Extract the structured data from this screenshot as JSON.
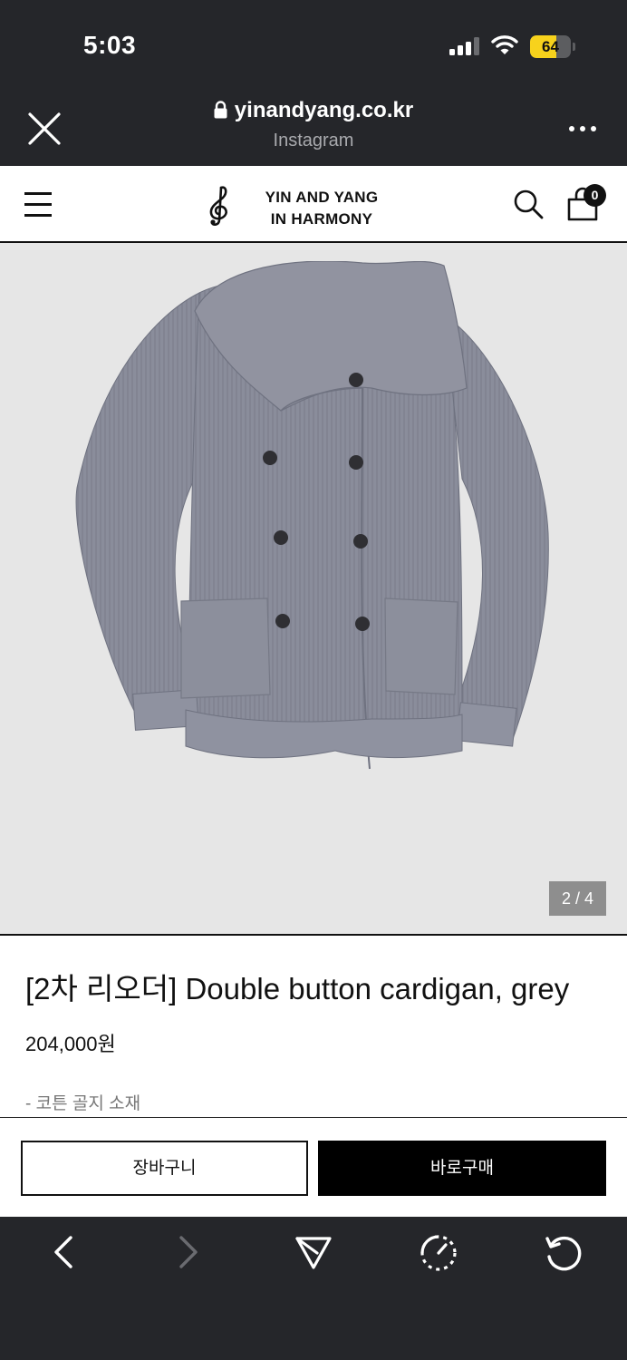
{
  "status_bar": {
    "time": "5:03",
    "battery_percent": "64",
    "battery_level": 0.64,
    "battery_color": "#f7d21c"
  },
  "browser": {
    "url": "yinandyang.co.kr",
    "source": "Instagram",
    "icons": [
      "close-icon",
      "lock-icon",
      "more-icon",
      "back-icon",
      "forward-icon",
      "share-icon",
      "compass-icon",
      "reload-icon"
    ]
  },
  "site": {
    "logo_line1": "YIN AND YANG",
    "logo_line2": "IN HARMONY",
    "cart_count": "0",
    "icons": [
      "menu-icon",
      "treble-clef-logo",
      "search-icon",
      "shopping-bag-icon"
    ]
  },
  "gallery": {
    "counter": "2 / 4",
    "background": "#e6e6e6",
    "product_color": "#8a8d9b"
  },
  "product": {
    "title": "[2차 리오더] Double button cardigan, grey",
    "price": "204,000원",
    "note": "- 코튼 골지 소재"
  },
  "actions": {
    "cart_label": "장바구니",
    "buy_label": "바로구매"
  },
  "colors": {
    "chrome": "#25262a",
    "text": "#111111",
    "buy_button": "#000000"
  }
}
